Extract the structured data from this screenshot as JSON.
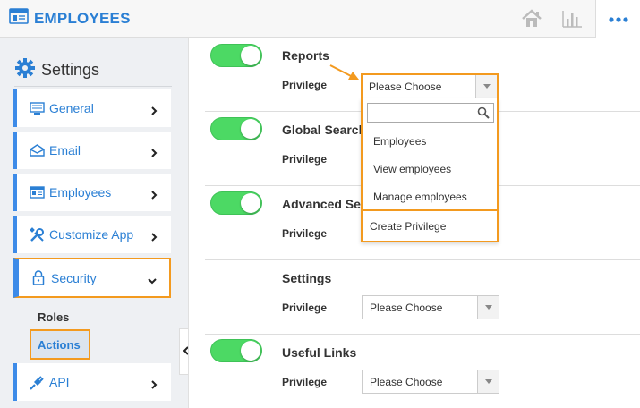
{
  "header": {
    "title": "EMPLOYEES",
    "icons": [
      "employees-card-icon",
      "home-icon",
      "bar-chart-icon",
      "more-icon"
    ]
  },
  "sidebar": {
    "heading": "Settings",
    "items": [
      {
        "label": "General",
        "icon": "monitor-icon"
      },
      {
        "label": "Email",
        "icon": "envelope-icon"
      },
      {
        "label": "Employees",
        "icon": "list-card-icon"
      },
      {
        "label": "Customize App",
        "icon": "wrench-icon"
      },
      {
        "label": "Security",
        "icon": "lock-icon"
      },
      {
        "label": "API",
        "icon": "plug-icon"
      }
    ],
    "security_sub": {
      "roles": "Roles",
      "actions": "Actions"
    }
  },
  "main": {
    "rows": [
      {
        "title": "Reports",
        "privilege_label": "Privilege",
        "toggle_on": true
      },
      {
        "title": "Global Search",
        "privilege_label": "Privilege",
        "toggle_on": true
      },
      {
        "title": "Advanced Search",
        "privilege_label": "Privilege",
        "toggle_on": true
      },
      {
        "title": "Settings",
        "privilege_label": "Privilege",
        "select_value": "Please Choose"
      },
      {
        "title": "Useful Links",
        "privilege_label": "Privilege",
        "toggle_on": true,
        "select_value": "Please Choose"
      }
    ]
  },
  "dropdown": {
    "selected": "Please Choose",
    "search_value": "",
    "options": [
      "Employees",
      "View employees",
      "Manage employees"
    ],
    "create_label": "Create Privilege"
  },
  "colors": {
    "brand": "#2a7fd4",
    "highlight": "#f39a1f",
    "toggle": "#4cd964"
  }
}
